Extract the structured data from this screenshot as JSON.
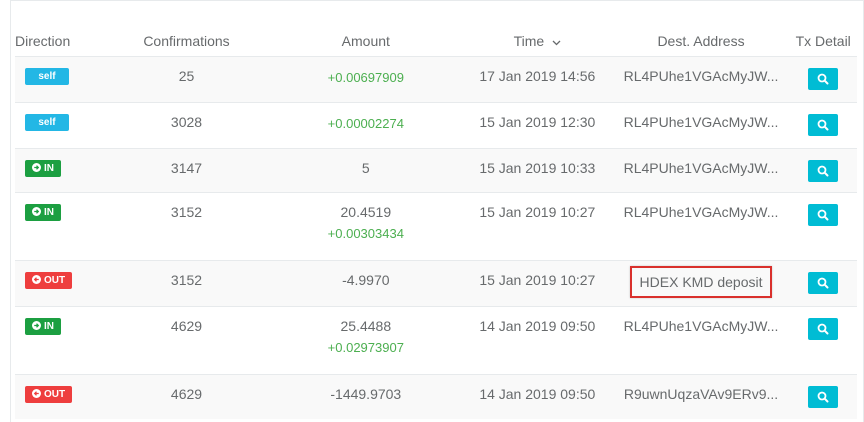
{
  "headers": {
    "direction": "Direction",
    "confirmations": "Confirmations",
    "amount": "Amount",
    "time": "Time",
    "dest": "Dest. Address",
    "txdetail": "Tx Detail"
  },
  "rows": [
    {
      "dir": "self",
      "conf": "25",
      "amount": "",
      "amount2": "+0.00697909",
      "time": "17 Jan 2019 14:56",
      "addr": "RL4PUhe1VGAcMyJW..."
    },
    {
      "dir": "self",
      "conf": "3028",
      "amount": "",
      "amount2": "+0.00002274",
      "time": "15 Jan 2019 12:30",
      "addr": "RL4PUhe1VGAcMyJW..."
    },
    {
      "dir": "IN",
      "conf": "3147",
      "amount": "5",
      "amount2": "",
      "time": "15 Jan 2019 10:33",
      "addr": "RL4PUhe1VGAcMyJW..."
    },
    {
      "dir": "IN",
      "conf": "3152",
      "amount": "20.4519",
      "amount2": "+0.00303434",
      "time": "15 Jan 2019 10:27",
      "addr": "RL4PUhe1VGAcMyJW..."
    },
    {
      "dir": "OUT",
      "conf": "3152",
      "amount": "-4.9970",
      "amount2": "",
      "time": "15 Jan 2019 10:27",
      "addr": "HDEX KMD deposit"
    },
    {
      "dir": "IN",
      "conf": "4629",
      "amount": "25.4488",
      "amount2": "+0.02973907",
      "time": "14 Jan 2019 09:50",
      "addr": "RL4PUhe1VGAcMyJW..."
    },
    {
      "dir": "OUT",
      "conf": "4629",
      "amount": "-1449.9703",
      "amount2": "",
      "time": "14 Jan 2019 09:50",
      "addr": "R9uwnUqzaVAv9ERv9..."
    }
  ],
  "icons": {
    "sort": "chevron-down-icon",
    "search": "search-icon"
  },
  "colors": {
    "self": "#23b7e5",
    "in": "#1c9f41",
    "out": "#ee3e3e",
    "positive": "#4caf50",
    "search_btn": "#00bcd4",
    "highlight": "#d9302c"
  }
}
